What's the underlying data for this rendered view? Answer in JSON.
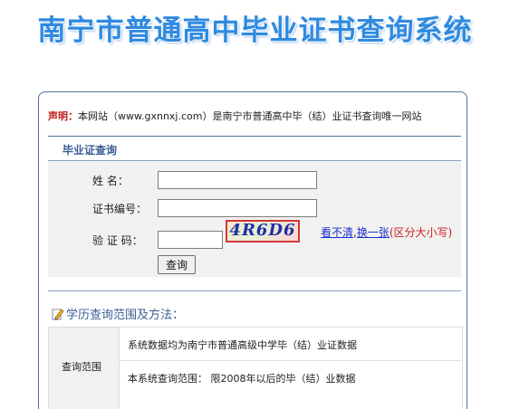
{
  "header": {
    "title": "南宁市普通高中毕业证书查询系统"
  },
  "notice": {
    "label": "声明：",
    "text": "本网站（www.gxnnxj.com）是南宁市普通高中毕（结）业证书查询唯一网站"
  },
  "query_section": {
    "title": "毕业证查询"
  },
  "form": {
    "name_label": "姓    名：",
    "name_value": "",
    "cert_label": "证书编号：",
    "cert_value": "",
    "captcha_label": "验  证  码：",
    "captcha_value": "",
    "captcha_code": "4R6D6",
    "refresh_link_1": "看不清",
    "refresh_separator": ",",
    "refresh_link_2": "换一张",
    "case_hint": "(区分大小写)",
    "submit_label": "查询"
  },
  "scope": {
    "heading": "学历查询范围及方法：",
    "label": "查询范围",
    "row1": "系统数据均为南宁市普通高级中学毕（结）业证数据",
    "row2": "本系统查询范围： 限2008年以后的毕（结）业数据"
  },
  "colors": {
    "title_blue": "#2f8ae0",
    "panel_border": "#4f6fa0",
    "section_title": "#3a5d93",
    "notice_red": "#c01c1c",
    "link_blue": "#1a2ed1",
    "captcha_border": "#d3373b"
  },
  "icons": {
    "scope_heading_icon": "pencil-icon"
  }
}
